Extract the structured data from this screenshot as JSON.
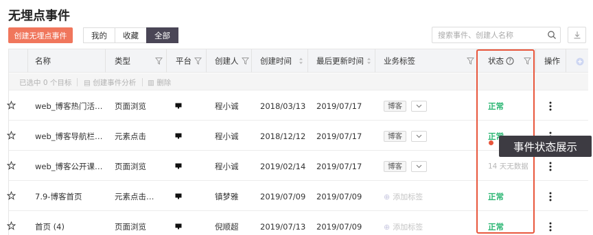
{
  "page": {
    "title": "无埋点事件"
  },
  "toolbar": {
    "create_label": "创建无埋点事件",
    "segments": [
      {
        "label": "我的",
        "active": false
      },
      {
        "label": "收藏",
        "active": false
      },
      {
        "label": "全部",
        "active": true
      }
    ],
    "search_placeholder": "搜索事件、创建人名称"
  },
  "columns": {
    "name": "名称",
    "type": "类型",
    "platform": "平台",
    "creator": "创建人",
    "created": "创建时间",
    "updated": "最后更新时间",
    "tags": "业务标签",
    "status": "状态",
    "actions": "操作"
  },
  "selection_bar": {
    "selected_text": "已选中 0 个目标",
    "analyze_label": "创建事件分析",
    "delete_label": "删除"
  },
  "rows": [
    {
      "name": "web_博客热门活…",
      "type": "页面浏览",
      "creator": "程小诚",
      "created": "2018/03/13",
      "updated": "2019/07/17",
      "tag": "博客",
      "has_tag": true,
      "status": "正常",
      "status_ok": true
    },
    {
      "name": "web_博客导航栏…",
      "type": "元素点击",
      "creator": "程小诚",
      "created": "2018/12/12",
      "updated": "2019/07/17",
      "tag": "博客",
      "has_tag": true,
      "status": "正常",
      "status_ok": true
    },
    {
      "name": "web_博客公开课…",
      "type": "页面浏览",
      "creator": "程小诚",
      "created": "2019/02/14",
      "updated": "2019/07/17",
      "tag": "博客",
      "has_tag": true,
      "status": "14 天无数据",
      "status_ok": false
    },
    {
      "name": "7.9-博客首页",
      "type": "元素点击…",
      "creator": "镇梦雅",
      "created": "2019/07/09",
      "updated": "2019/07/09",
      "tag": "添加标签",
      "has_tag": false,
      "status": "正常",
      "status_ok": true
    },
    {
      "name": "首页 (4)",
      "type": "页面浏览",
      "creator": "倪顺超",
      "created": "2019/07/13",
      "updated": "2019/07/09",
      "tag": "添加标签",
      "has_tag": false,
      "status": "正常",
      "status_ok": true
    }
  ],
  "annotation": {
    "callout_text": "事件状态展示",
    "highlight_color": "#e8553b"
  },
  "colors": {
    "primary": "#f0765c",
    "active_segment": "#4a4656",
    "status_ok": "#2bb673"
  },
  "icons": [
    "star-icon",
    "monitor-icon",
    "filter-icon",
    "sort-icon",
    "search-icon",
    "download-icon",
    "more-icon",
    "help-icon",
    "add-column-icon",
    "chevron-down-icon"
  ]
}
